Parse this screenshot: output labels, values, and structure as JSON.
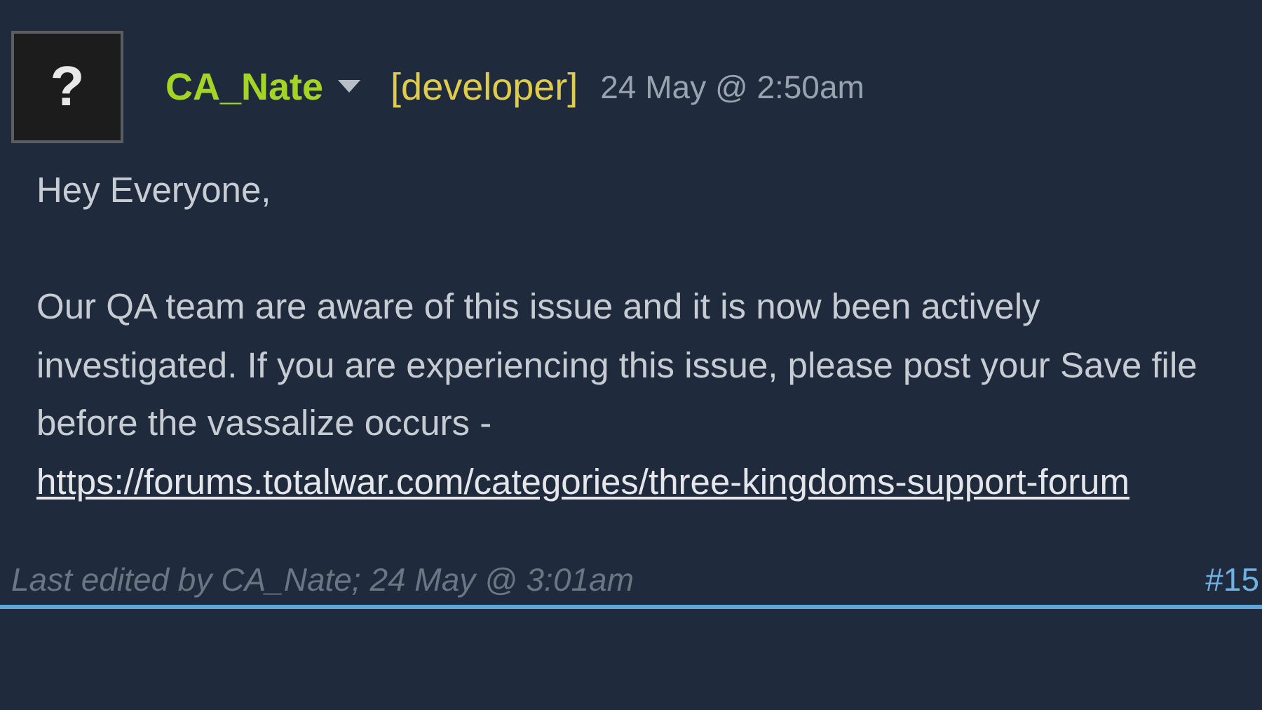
{
  "post": {
    "avatar": "?",
    "author": "CA_Nate",
    "role": "[developer]",
    "date": "24 May @ 2:50am",
    "paragraphs": [
      "Hey Everyone,",
      "Our QA team are aware of this issue and it is now been actively investigated. If you are experiencing this issue, please post your Save file before the vassalize occurs -"
    ],
    "link": "https://forums.totalwar.com/categories/three-kingdoms-support-forum",
    "edited": "Last edited by CA_Nate; 24 May @ 3:01am",
    "number": "#15"
  }
}
